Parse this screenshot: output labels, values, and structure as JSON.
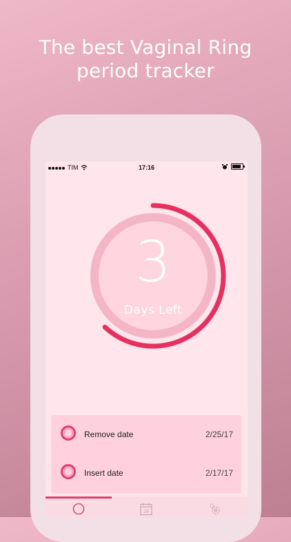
{
  "promo": {
    "headline_line1": "The best Vaginal Ring",
    "headline_line2": "period tracker"
  },
  "status_bar": {
    "carrier": "TIM",
    "time": "17:16"
  },
  "countdown": {
    "days_number": "3",
    "days_label": "Days Left",
    "progress_fraction": 0.62,
    "ring_color": "#e6305f"
  },
  "dates": [
    {
      "label": "Remove date",
      "value": "2/25/17"
    },
    {
      "label": "Insert date",
      "value": "2/17/17"
    }
  ],
  "tab_bar": {
    "tabs": [
      {
        "icon": "ring-icon"
      },
      {
        "icon": "calendar-icon",
        "badge": "28"
      },
      {
        "icon": "settings-gear-icon"
      }
    ],
    "active_index": 0
  },
  "colors": {
    "accent": "#e03d6d",
    "screen_bg": "#ffe6ec"
  }
}
